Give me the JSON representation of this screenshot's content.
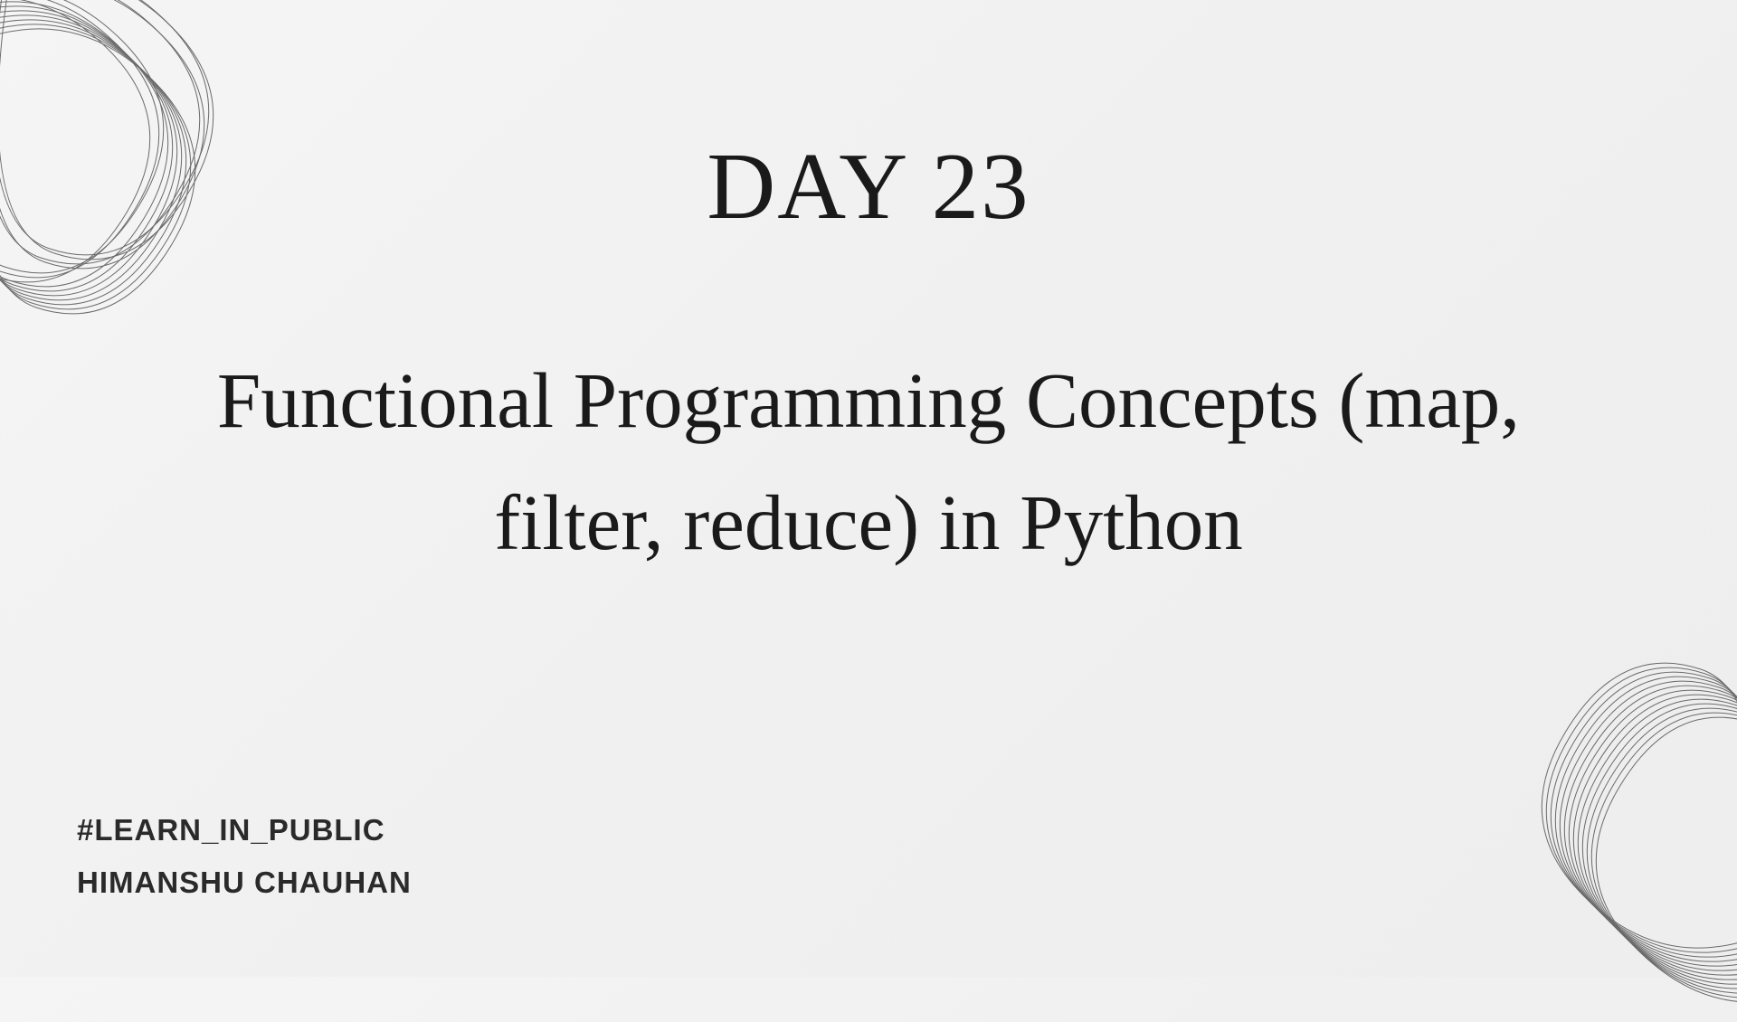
{
  "slide": {
    "title": "DAY 23",
    "subtitle": "Functional Programming Concepts (map, filter, reduce) in Python"
  },
  "footer": {
    "hashtag": "#LEARN_IN_PUBLIC",
    "author": "HIMANSHU CHAUHAN"
  }
}
